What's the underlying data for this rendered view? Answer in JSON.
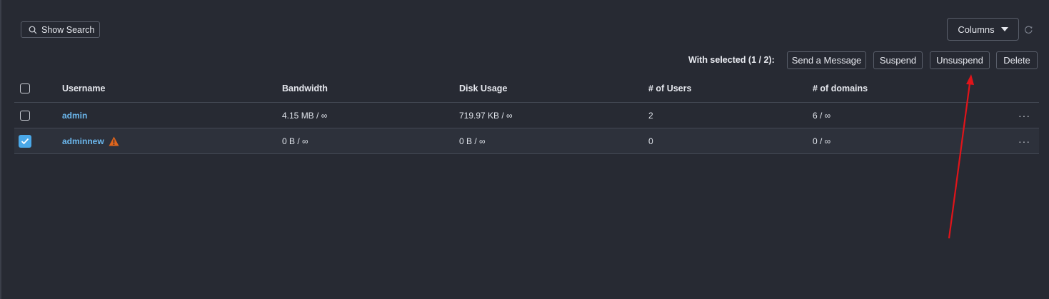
{
  "toolbar": {
    "show_search_label": "Show Search",
    "columns_label": "Columns",
    "with_selected_label": "With selected (1 / 2):",
    "actions": {
      "send_message": "Send a Message",
      "suspend": "Suspend",
      "unsuspend": "Unsuspend",
      "delete": "Delete"
    }
  },
  "table": {
    "columns": [
      "Username",
      "Bandwidth",
      "Disk Usage",
      "# of Users",
      "# of domains"
    ],
    "rows": [
      {
        "username": "admin",
        "bandwidth": "4.15 MB / ∞",
        "disk_usage": "719.97 KB / ∞",
        "users": "2",
        "domains": "6 / ∞",
        "checked": false,
        "warning": false
      },
      {
        "username": "adminnew",
        "bandwidth": "0 B / ∞",
        "disk_usage": "0 B / ∞",
        "users": "0",
        "domains": "0 / ∞",
        "checked": true,
        "warning": true
      }
    ],
    "row_menu_glyph": "···"
  },
  "colors": {
    "background": "#272a33",
    "link": "#6cb8ee",
    "checkbox_checked": "#4aa8e8",
    "warning": "#e0651c",
    "annotation_arrow": "#e0141a"
  },
  "icons": [
    "search-icon",
    "caret-down-icon",
    "refresh-icon",
    "warning-icon",
    "check-icon",
    "more-icon"
  ]
}
